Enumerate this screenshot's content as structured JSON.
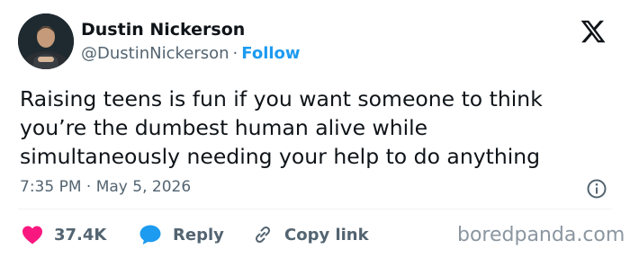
{
  "author": {
    "name": "Dustin Nickerson",
    "handle": "@DustinNickerson",
    "separator": "·",
    "follow_label": "Follow"
  },
  "tweet": {
    "lines": [
      "Raising teens is fun if you want someone to think",
      "you’re the dumbest human alive while",
      "simultaneously needing your help to do anything"
    ],
    "timestamp": "7:35 PM · May 5, 2026"
  },
  "actions": {
    "likes": "37.4K",
    "reply_label": "Reply",
    "copy_link_label": "Copy link"
  },
  "watermark": "boredpanda.com",
  "colors": {
    "text": "#0f1419",
    "secondary": "#536471",
    "accent": "#1d9bf0",
    "heart": "#f91880"
  },
  "icons": [
    "x-logo-icon",
    "info-icon",
    "heart-icon",
    "reply-bubble-icon",
    "link-icon"
  ]
}
